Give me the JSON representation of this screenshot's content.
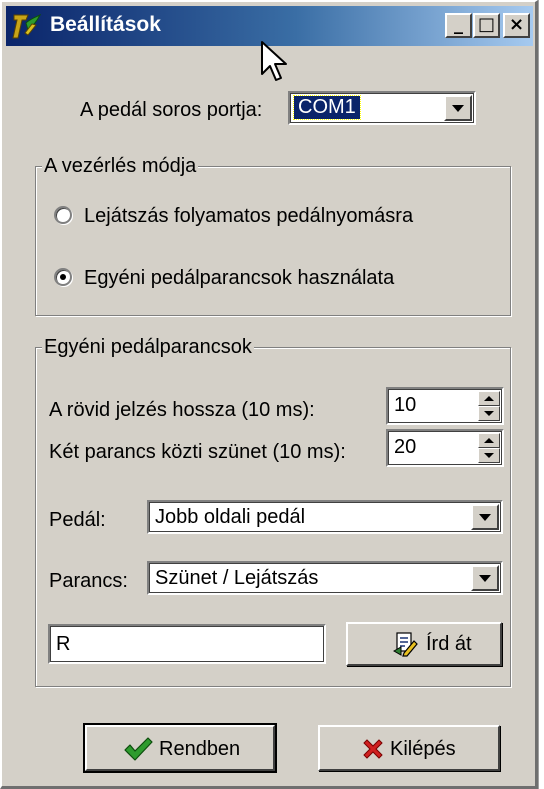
{
  "window": {
    "title": "Beállítások",
    "controls": {
      "minimize": "_",
      "maximize": "□",
      "close": "×"
    }
  },
  "serial_port": {
    "label": "A pedál soros portja:",
    "value": "COM1"
  },
  "control_mode": {
    "legend": "A vezérlés módja",
    "options": [
      {
        "label": "Lejátszás folyamatos pedálnyomásra",
        "checked": false
      },
      {
        "label": "Egyéni pedálparancsok használata",
        "checked": true
      }
    ]
  },
  "custom_commands": {
    "legend": "Egyéni pedálparancsok",
    "short_signal": {
      "label": "A rövid jelzés hossza (10 ms):",
      "value": "10"
    },
    "pause": {
      "label": "Két parancs közti szünet (10 ms):",
      "value": "20"
    },
    "pedal": {
      "label": "Pedál:",
      "value": "Jobb oldali pedál"
    },
    "command": {
      "label": "Parancs:",
      "value": "Szünet / Lejátszás"
    },
    "key_field": {
      "value": "R"
    },
    "rewrite_button": {
      "label": "Írd át",
      "icon": "edit-document-icon"
    }
  },
  "footer": {
    "ok_button": {
      "label": "Rendben",
      "icon": "checkmark-icon"
    },
    "exit_button": {
      "label": "Kilépés",
      "icon": "red-x-icon"
    }
  },
  "colors": {
    "titlebar_start": "#0a246a",
    "titlebar_end": "#a6caf0",
    "face": "#d4d0c8",
    "selection": "#0a246a"
  }
}
